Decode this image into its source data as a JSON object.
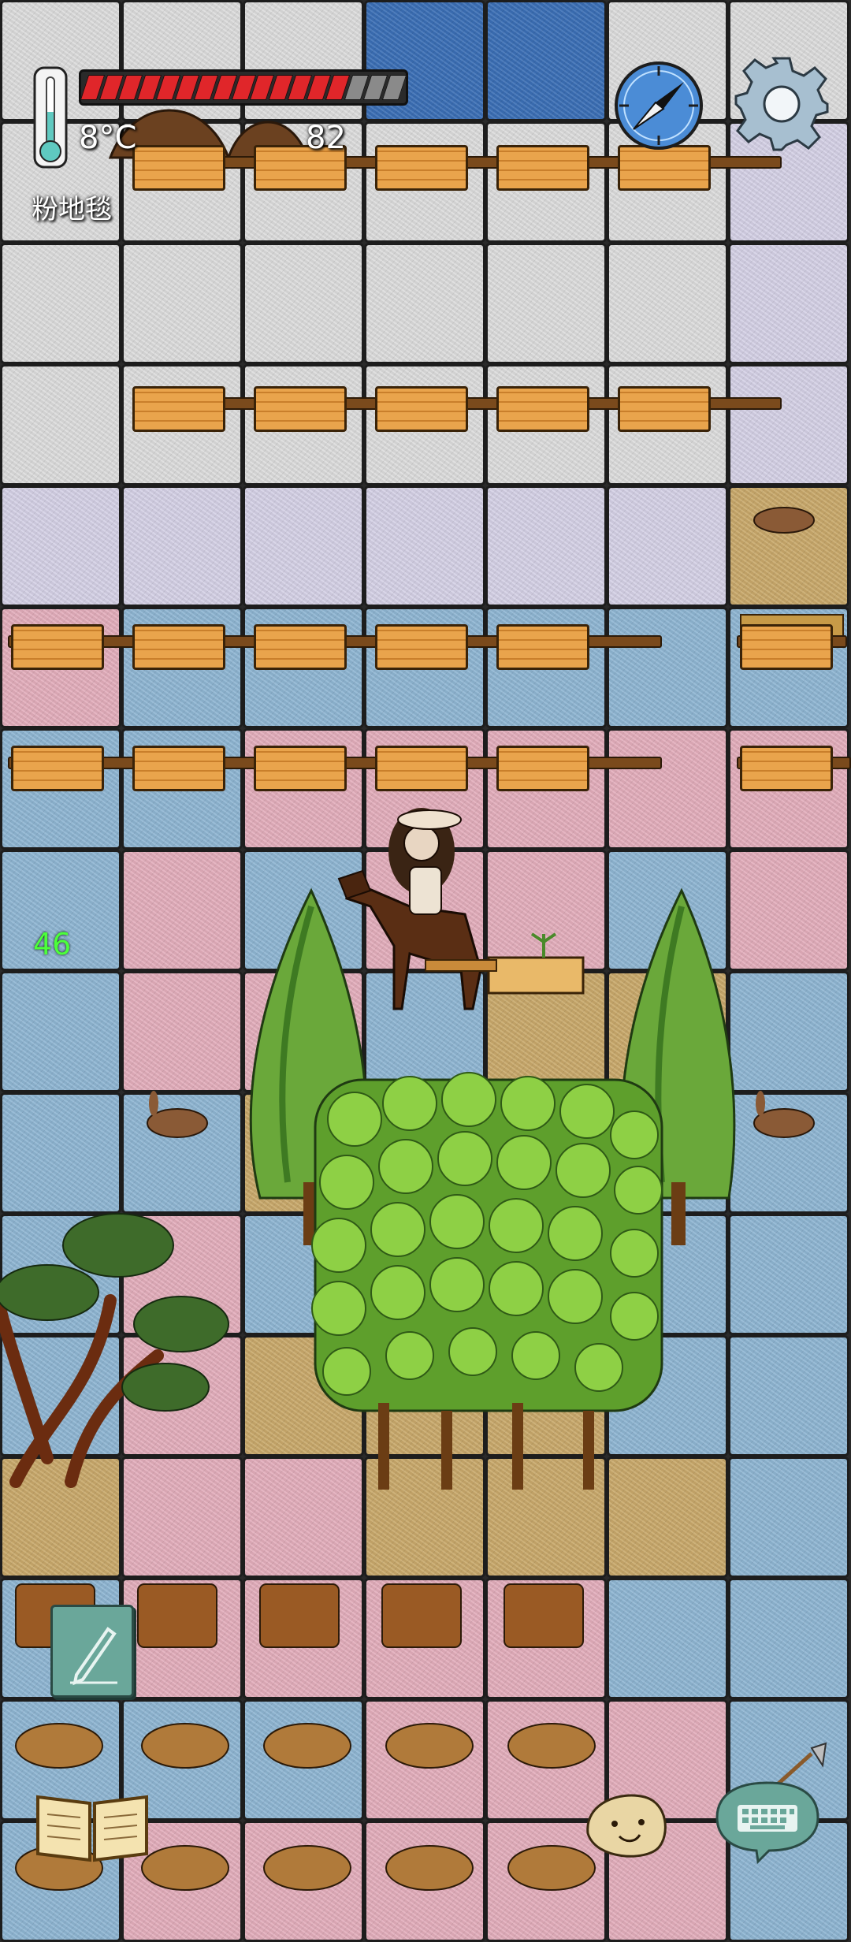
{
  "hud": {
    "temperature": "8°C",
    "food_count": "82",
    "floor_label": "粉地毯",
    "health_segments_total": 17,
    "health_segments_filled": 14,
    "age": "46"
  },
  "colors": {
    "white_carpet": "#dcdcdc",
    "lavender_carpet": "#d5d1e6",
    "pink_carpet": "#e3aebc",
    "blue_carpet": "#8fb6d3",
    "dark_blue_carpet": "#3b6fb6",
    "sand": "#c9a96b",
    "health_red": "#e0262a",
    "health_empty": "#8a8a8a",
    "age_text": "#4cff3a"
  },
  "icons": {
    "thermometer": "thermometer-icon",
    "compass": "compass-icon",
    "settings": "gear-icon",
    "note": "pencil-note-icon",
    "journal": "open-book-icon",
    "emote": "potato-face-icon",
    "keyboard": "keyboard-chat-icon"
  }
}
